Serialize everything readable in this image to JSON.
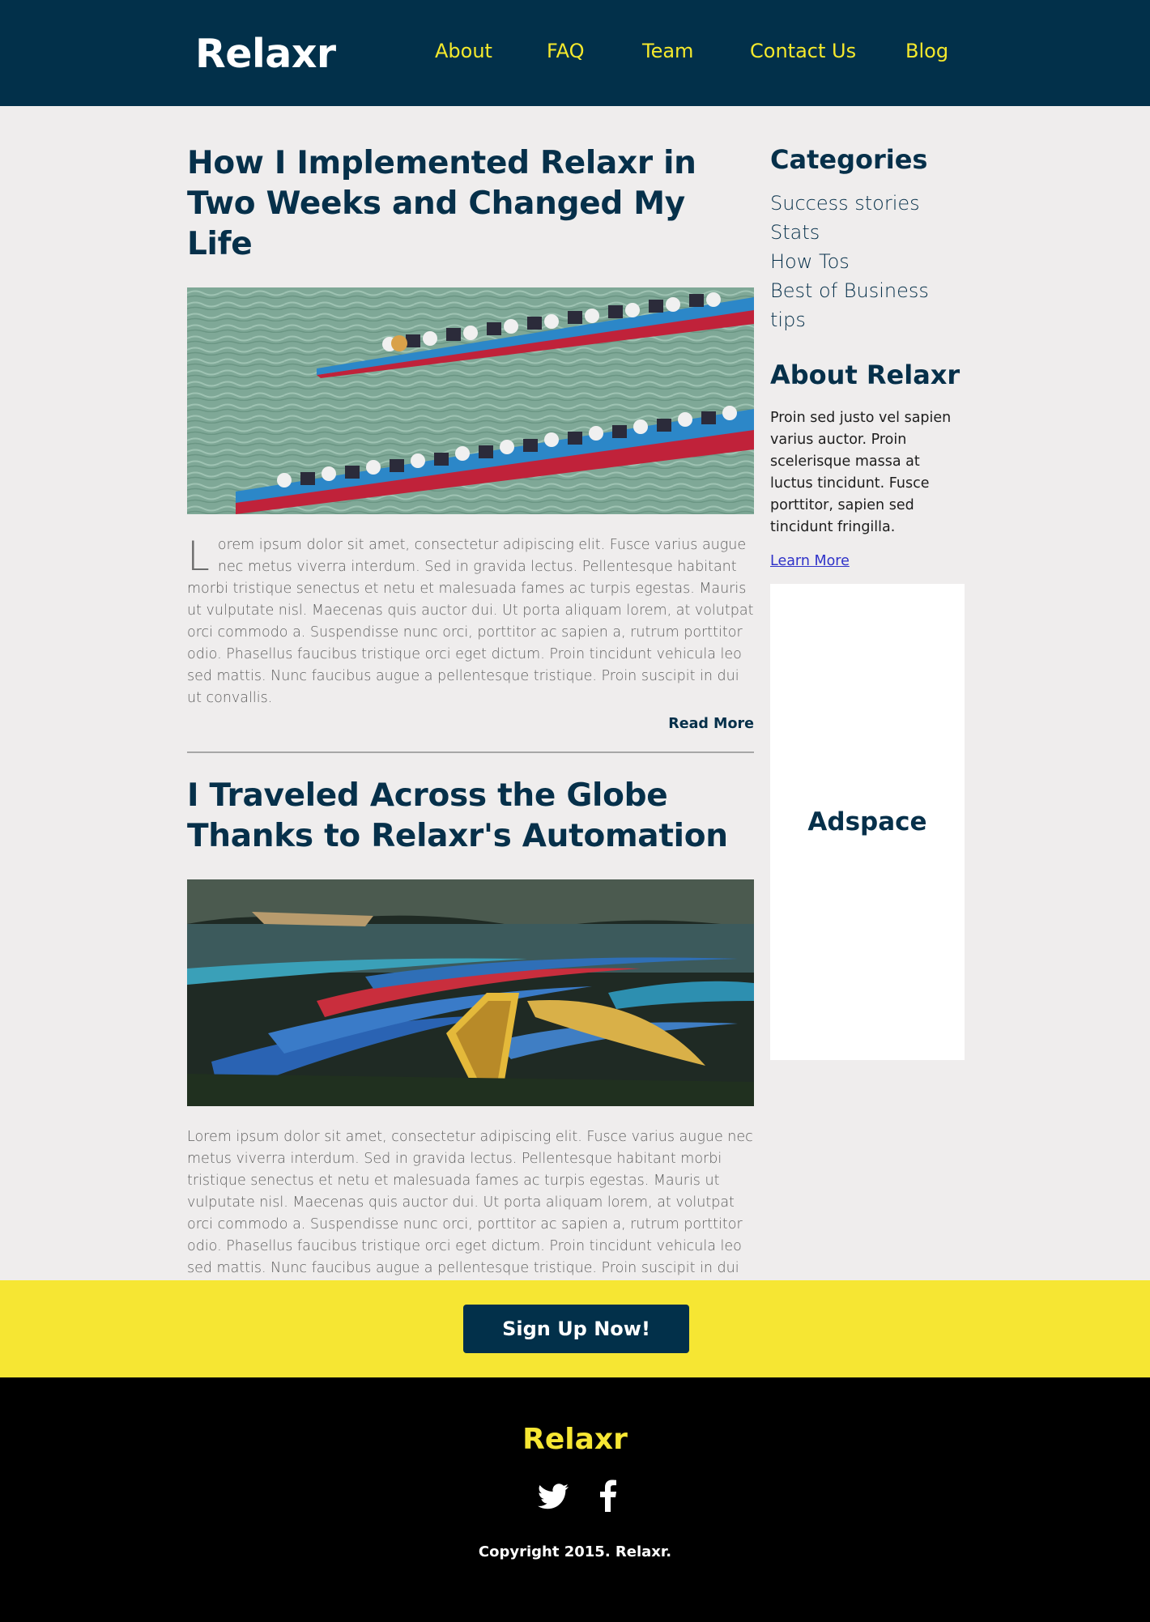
{
  "header": {
    "logo": "Relaxr",
    "nav": [
      "About",
      "FAQ",
      "Team",
      "Contact Us",
      "Blog"
    ]
  },
  "posts": [
    {
      "title": "How I Implemented Relaxr in Two Weeks and Changed My Life",
      "image": "dragon-boat-race-image",
      "dropcap": "L",
      "body": "orem ipsum dolor sit amet, consectetur adipiscing elit. Fusce varius augue nec metus viverra interdum. Sed in gravida lectus. Pellentesque habitant morbi tristique senectus et netu et malesuada fames ac turpis egestas. Mauris ut vulputate nisl. Maecenas quis auctor dui. Ut porta aliquam lorem, at volutpat orci commodo a. Suspendisse nunc orci, porttitor ac sapien a, rutrum porttitor odio. Phasellus faucibus tristique orci eget dictum. Proin tincidunt vehicula leo sed mattis. Nunc faucibus augue a pellentesque tristique. Proin suscipit in dui ut convallis.",
      "read_more": "Read More"
    },
    {
      "title": "I Traveled Across the Globe Thanks to Relaxr's Automation",
      "image": "colorful-boats-lake-image",
      "body": "Lorem ipsum dolor sit amet, consectetur adipiscing elit. Fusce varius augue nec metus viverra interdum. Sed in gravida lectus. Pellentesque habitant morbi tristique senectus et netu et malesuada fames ac turpis egestas. Mauris ut vulputate nisl. Maecenas quis auctor dui. Ut porta aliquam lorem, at volutpat orci commodo a. Suspendisse nunc orci, porttitor ac sapien a, rutrum porttitor odio. Phasellus faucibus tristique orci eget dictum. Proin tincidunt vehicula leo sed mattis. Nunc faucibus augue a pellentesque tristique. Proin suscipit in dui ut convallis."
    }
  ],
  "sidebar": {
    "categories_heading": "Categories",
    "categories": [
      "Success stories",
      "Stats",
      "How Tos",
      "Best of Business tips"
    ],
    "about_heading": "About Relaxr",
    "about_text": "Proin sed justo vel sapien varius auctor. Proin scelerisque massa at luctus tincidunt. Fusce porttitor, sapien sed tincidunt fringilla.",
    "learn_more": "Learn More",
    "adspace": "Adspace"
  },
  "cta": {
    "button": "Sign Up Now!"
  },
  "footer": {
    "logo": "Relaxr",
    "social_icons": [
      "twitter-icon",
      "facebook-icon"
    ],
    "copyright": "Copyright 2015. Relaxr."
  },
  "colors": {
    "navy": "#02304a",
    "yellow": "#f6e633",
    "background": "#efeded",
    "link": "#2f32c9"
  }
}
